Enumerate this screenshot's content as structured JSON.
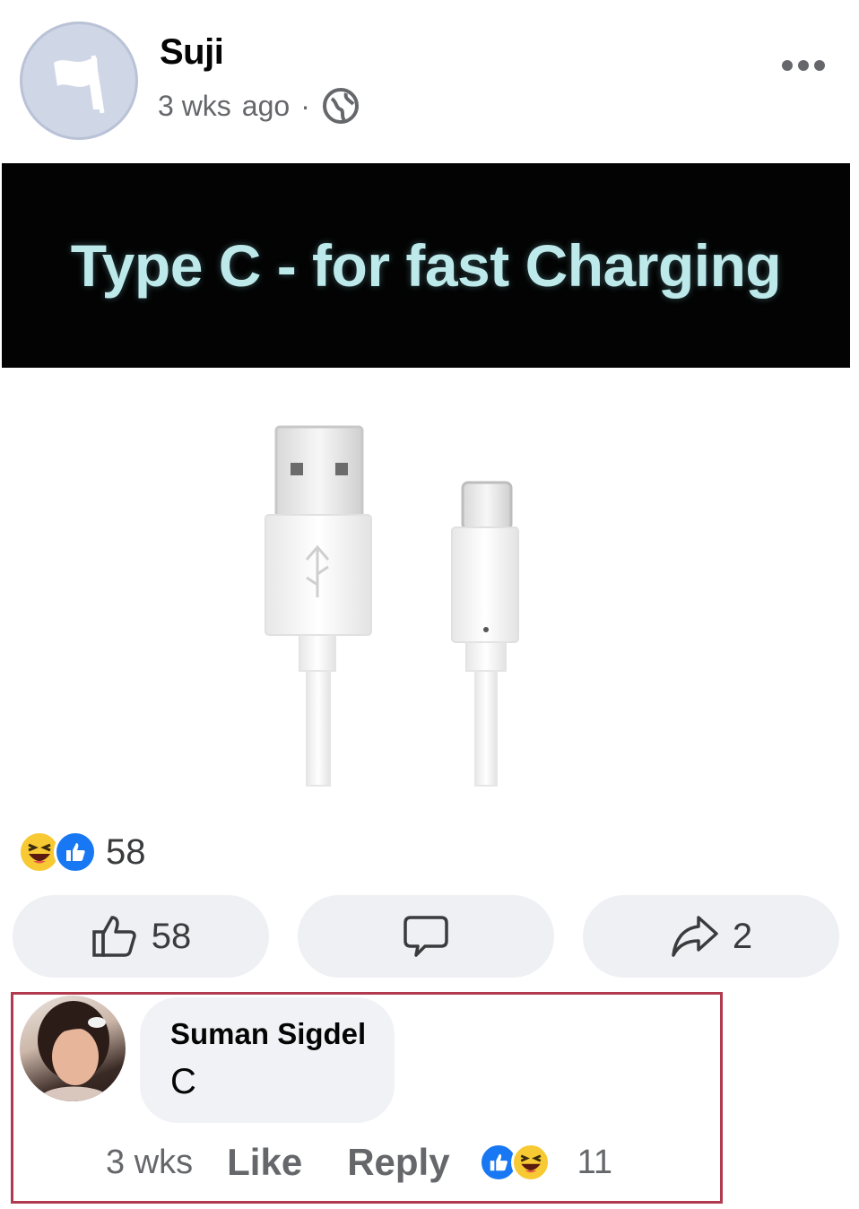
{
  "post": {
    "author": "Suji",
    "time": "3 wks",
    "time_suffix": "ago",
    "separator": "·",
    "audience_icon": "globe-icon",
    "more_icon": "more-dots-icon",
    "banner_text": "Type C - for fast Charging",
    "banner_text_color": "#bde9ea"
  },
  "reactions": {
    "icons": [
      "haha-emoji-icon",
      "like-emoji-icon"
    ],
    "count": "58"
  },
  "actions": {
    "like_count": "58",
    "share_count": "2"
  },
  "comment": {
    "author": "Suman Sigdel",
    "text": "C",
    "time": "3 wks",
    "like_label": "Like",
    "reply_label": "Reply",
    "reaction_count": "11",
    "highlight_color": "#b23a4e"
  }
}
